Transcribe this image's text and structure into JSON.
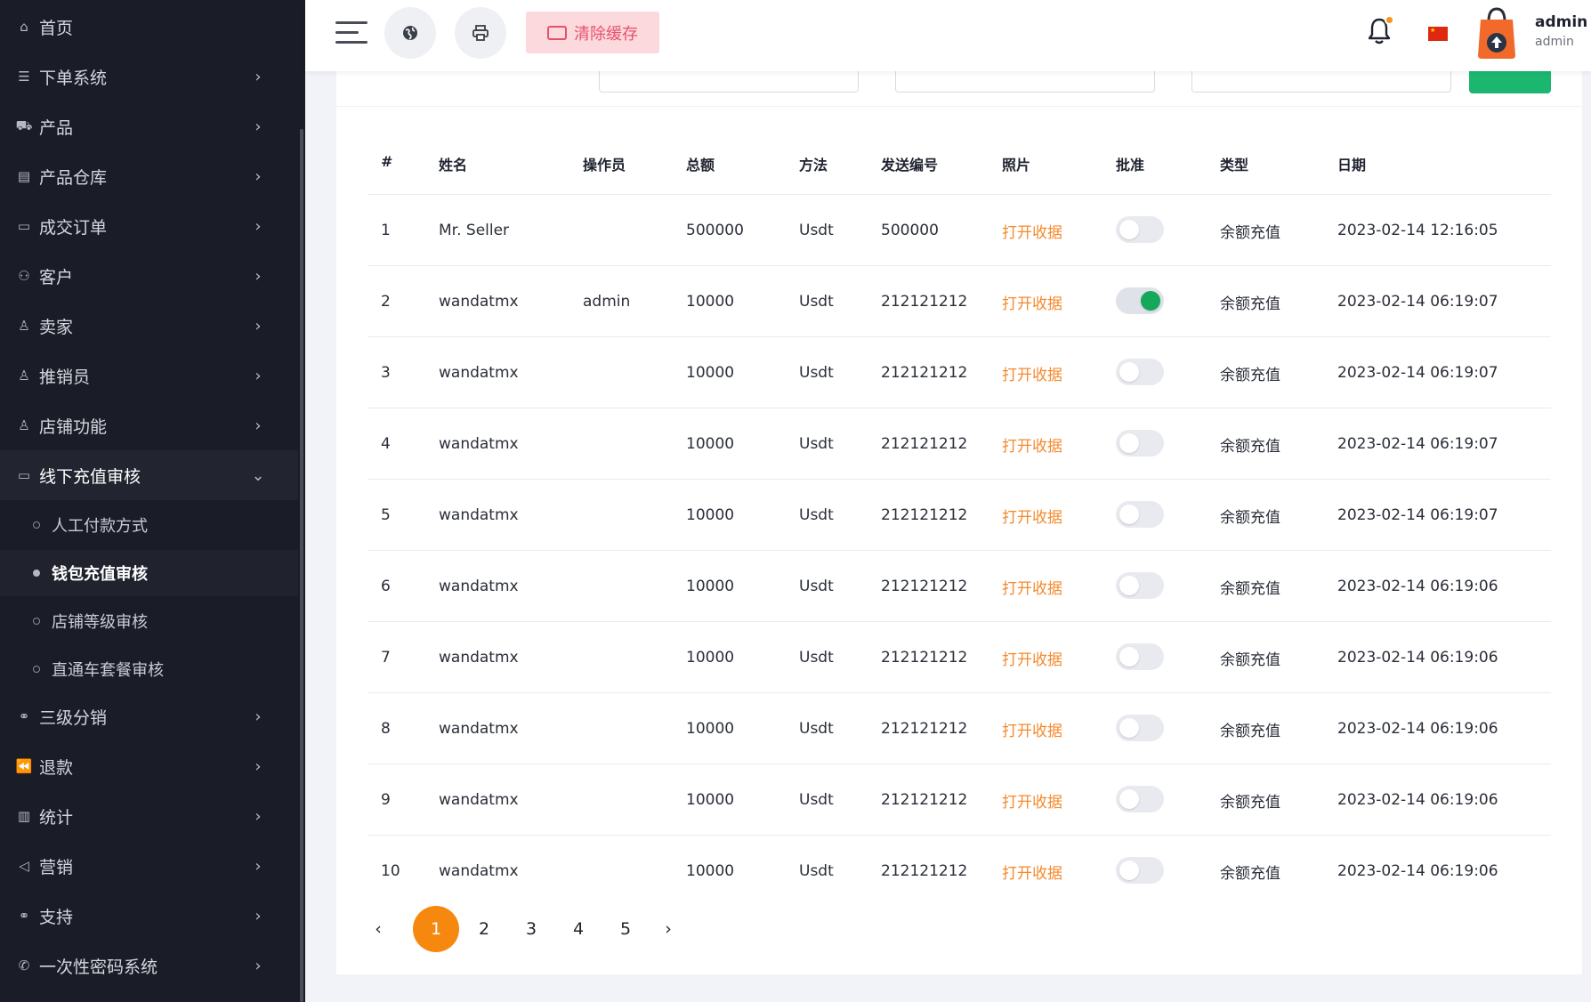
{
  "sidebar": {
    "items": [
      {
        "label": "首页",
        "icon": "home-icon",
        "glyph": "⌂",
        "chevron": ""
      },
      {
        "label": "下单系统",
        "icon": "list-icon",
        "glyph": "☰",
        "chevron": "›"
      },
      {
        "label": "产品",
        "icon": "cart-icon",
        "glyph": "⛟",
        "chevron": "›"
      },
      {
        "label": "产品仓库",
        "icon": "warehouse-icon",
        "glyph": "▤",
        "chevron": "›"
      },
      {
        "label": "成交订单",
        "icon": "money-icon",
        "glyph": "▭",
        "chevron": "›"
      },
      {
        "label": "客户",
        "icon": "users-icon",
        "glyph": "⚇",
        "chevron": "›"
      },
      {
        "label": "卖家",
        "icon": "user-icon",
        "glyph": "♙",
        "chevron": "›"
      },
      {
        "label": "推销员",
        "icon": "user-icon",
        "glyph": "♙",
        "chevron": "›"
      },
      {
        "label": "店铺功能",
        "icon": "user-icon",
        "glyph": "♙",
        "chevron": "›"
      },
      {
        "label": "线下充值审核",
        "icon": "money-icon",
        "glyph": "▭",
        "chevron": "⌄"
      }
    ],
    "sub_items": [
      {
        "label": "人工付款方式"
      },
      {
        "label": "钱包充值审核"
      },
      {
        "label": "店铺等级审核"
      },
      {
        "label": "直通车套餐审核"
      }
    ],
    "items_after": [
      {
        "label": "三级分销",
        "icon": "link-icon",
        "glyph": "⚭",
        "chevron": "›"
      },
      {
        "label": "退款",
        "icon": "rewind-icon",
        "glyph": "⏪",
        "chevron": "›"
      },
      {
        "label": "统计",
        "icon": "document-icon",
        "glyph": "▥",
        "chevron": "›"
      },
      {
        "label": "营销",
        "icon": "megaphone-icon",
        "glyph": "◁",
        "chevron": "›"
      },
      {
        "label": "支持",
        "icon": "link-icon",
        "glyph": "⚭",
        "chevron": "›"
      },
      {
        "label": "一次性密码系统",
        "icon": "phone-icon",
        "glyph": "✆",
        "chevron": "›"
      }
    ]
  },
  "header": {
    "clear_cache": "清除缓存",
    "user_name": "admin",
    "user_role": "admin"
  },
  "table": {
    "headers": [
      "#",
      "姓名",
      "操作员",
      "总额",
      "方法",
      "发送编号",
      "照片",
      "批准",
      "类型",
      "日期"
    ],
    "rows": [
      {
        "idx": "1",
        "name": "Mr. Seller",
        "operator": "",
        "amount": "500000",
        "method": "Usdt",
        "send_no": "500000",
        "photo": "打开收据",
        "approved": false,
        "type": "余额充值",
        "date": "2023-02-14 12:16:05"
      },
      {
        "idx": "2",
        "name": "wandatmx",
        "operator": "admin",
        "amount": "10000",
        "method": "Usdt",
        "send_no": "212121212",
        "photo": "打开收据",
        "approved": true,
        "type": "余额充值",
        "date": "2023-02-14 06:19:07"
      },
      {
        "idx": "3",
        "name": "wandatmx",
        "operator": "",
        "amount": "10000",
        "method": "Usdt",
        "send_no": "212121212",
        "photo": "打开收据",
        "approved": false,
        "type": "余额充值",
        "date": "2023-02-14 06:19:07"
      },
      {
        "idx": "4",
        "name": "wandatmx",
        "operator": "",
        "amount": "10000",
        "method": "Usdt",
        "send_no": "212121212",
        "photo": "打开收据",
        "approved": false,
        "type": "余额充值",
        "date": "2023-02-14 06:19:07"
      },
      {
        "idx": "5",
        "name": "wandatmx",
        "operator": "",
        "amount": "10000",
        "method": "Usdt",
        "send_no": "212121212",
        "photo": "打开收据",
        "approved": false,
        "type": "余额充值",
        "date": "2023-02-14 06:19:07"
      },
      {
        "idx": "6",
        "name": "wandatmx",
        "operator": "",
        "amount": "10000",
        "method": "Usdt",
        "send_no": "212121212",
        "photo": "打开收据",
        "approved": false,
        "type": "余额充值",
        "date": "2023-02-14 06:19:06"
      },
      {
        "idx": "7",
        "name": "wandatmx",
        "operator": "",
        "amount": "10000",
        "method": "Usdt",
        "send_no": "212121212",
        "photo": "打开收据",
        "approved": false,
        "type": "余额充值",
        "date": "2023-02-14 06:19:06"
      },
      {
        "idx": "8",
        "name": "wandatmx",
        "operator": "",
        "amount": "10000",
        "method": "Usdt",
        "send_no": "212121212",
        "photo": "打开收据",
        "approved": false,
        "type": "余额充值",
        "date": "2023-02-14 06:19:06"
      },
      {
        "idx": "9",
        "name": "wandatmx",
        "operator": "",
        "amount": "10000",
        "method": "Usdt",
        "send_no": "212121212",
        "photo": "打开收据",
        "approved": false,
        "type": "余额充值",
        "date": "2023-02-14 06:19:06"
      },
      {
        "idx": "10",
        "name": "wandatmx",
        "operator": "",
        "amount": "10000",
        "method": "Usdt",
        "send_no": "212121212",
        "photo": "打开收据",
        "approved": false,
        "type": "余额充值",
        "date": "2023-02-14 06:19:06"
      }
    ]
  },
  "pagination": {
    "prev": "‹",
    "pages": [
      "1",
      "2",
      "3",
      "4",
      "5"
    ],
    "current": "1",
    "next": "›"
  },
  "colors": {
    "sidebar_bg": "#1a1d28",
    "accent_orange": "#f7880f",
    "link_orange": "#f5892d",
    "toggle_on": "#13a85a",
    "clear_btn_bg": "#fbd9dd",
    "clear_btn_text": "#e8506a",
    "search_green": "#1bb770"
  }
}
